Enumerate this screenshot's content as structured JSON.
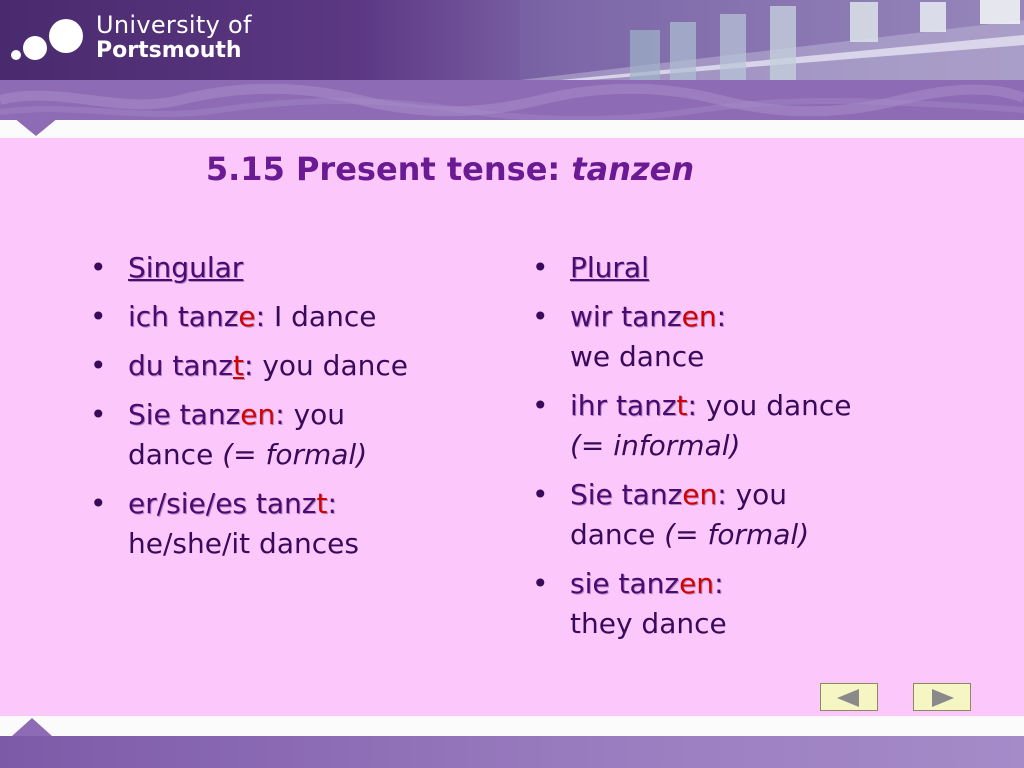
{
  "header": {
    "brand_line1": "University of",
    "brand_line2": "Portsmouth"
  },
  "slide": {
    "title_prefix": "5.15 Present tense: ",
    "title_italic": "tanzen"
  },
  "bullet_char": "•",
  "singular": {
    "heading": "Singular",
    "ich": {
      "stem": "ich tanz",
      "ending": "e",
      "colon": ":",
      "translation": " I dance"
    },
    "du": {
      "stem": "du tanz",
      "ending": "t",
      "colon": ":",
      "translation": " you dance"
    },
    "sie_formal": {
      "stem": "Sie tanz",
      "ending": "en",
      "colon": ":",
      "translation_line1": " you",
      "translation_line2": "dance ",
      "note": "(= formal)"
    },
    "er": {
      "stem": "er/sie/es tanz",
      "ending": "t",
      "colon": ":",
      "translation": "he/she/it dances"
    }
  },
  "plural": {
    "heading": "Plural",
    "wir": {
      "stem": "wir tanz",
      "ending": "en",
      "colon": ":",
      "translation": "we dance"
    },
    "ihr": {
      "stem": "ihr tanz",
      "ending": "t",
      "colon": ":",
      "translation": " you dance",
      "note": "(= informal)"
    },
    "sie_formal": {
      "stem": "Sie tanz",
      "ending": "en",
      "colon": ":",
      "translation_line1": " you",
      "translation_line2": "dance ",
      "note": "(= formal)"
    },
    "sie": {
      "stem": "sie tanz",
      "ending": "en",
      "colon": ":",
      "translation": "they dance"
    }
  },
  "nav": {
    "prev_icon": "triangle-left-icon",
    "next_icon": "triangle-right-icon"
  },
  "colors": {
    "content_bg": "#fcc8fc",
    "title": "#6a1a92",
    "ending": "#d40000"
  }
}
